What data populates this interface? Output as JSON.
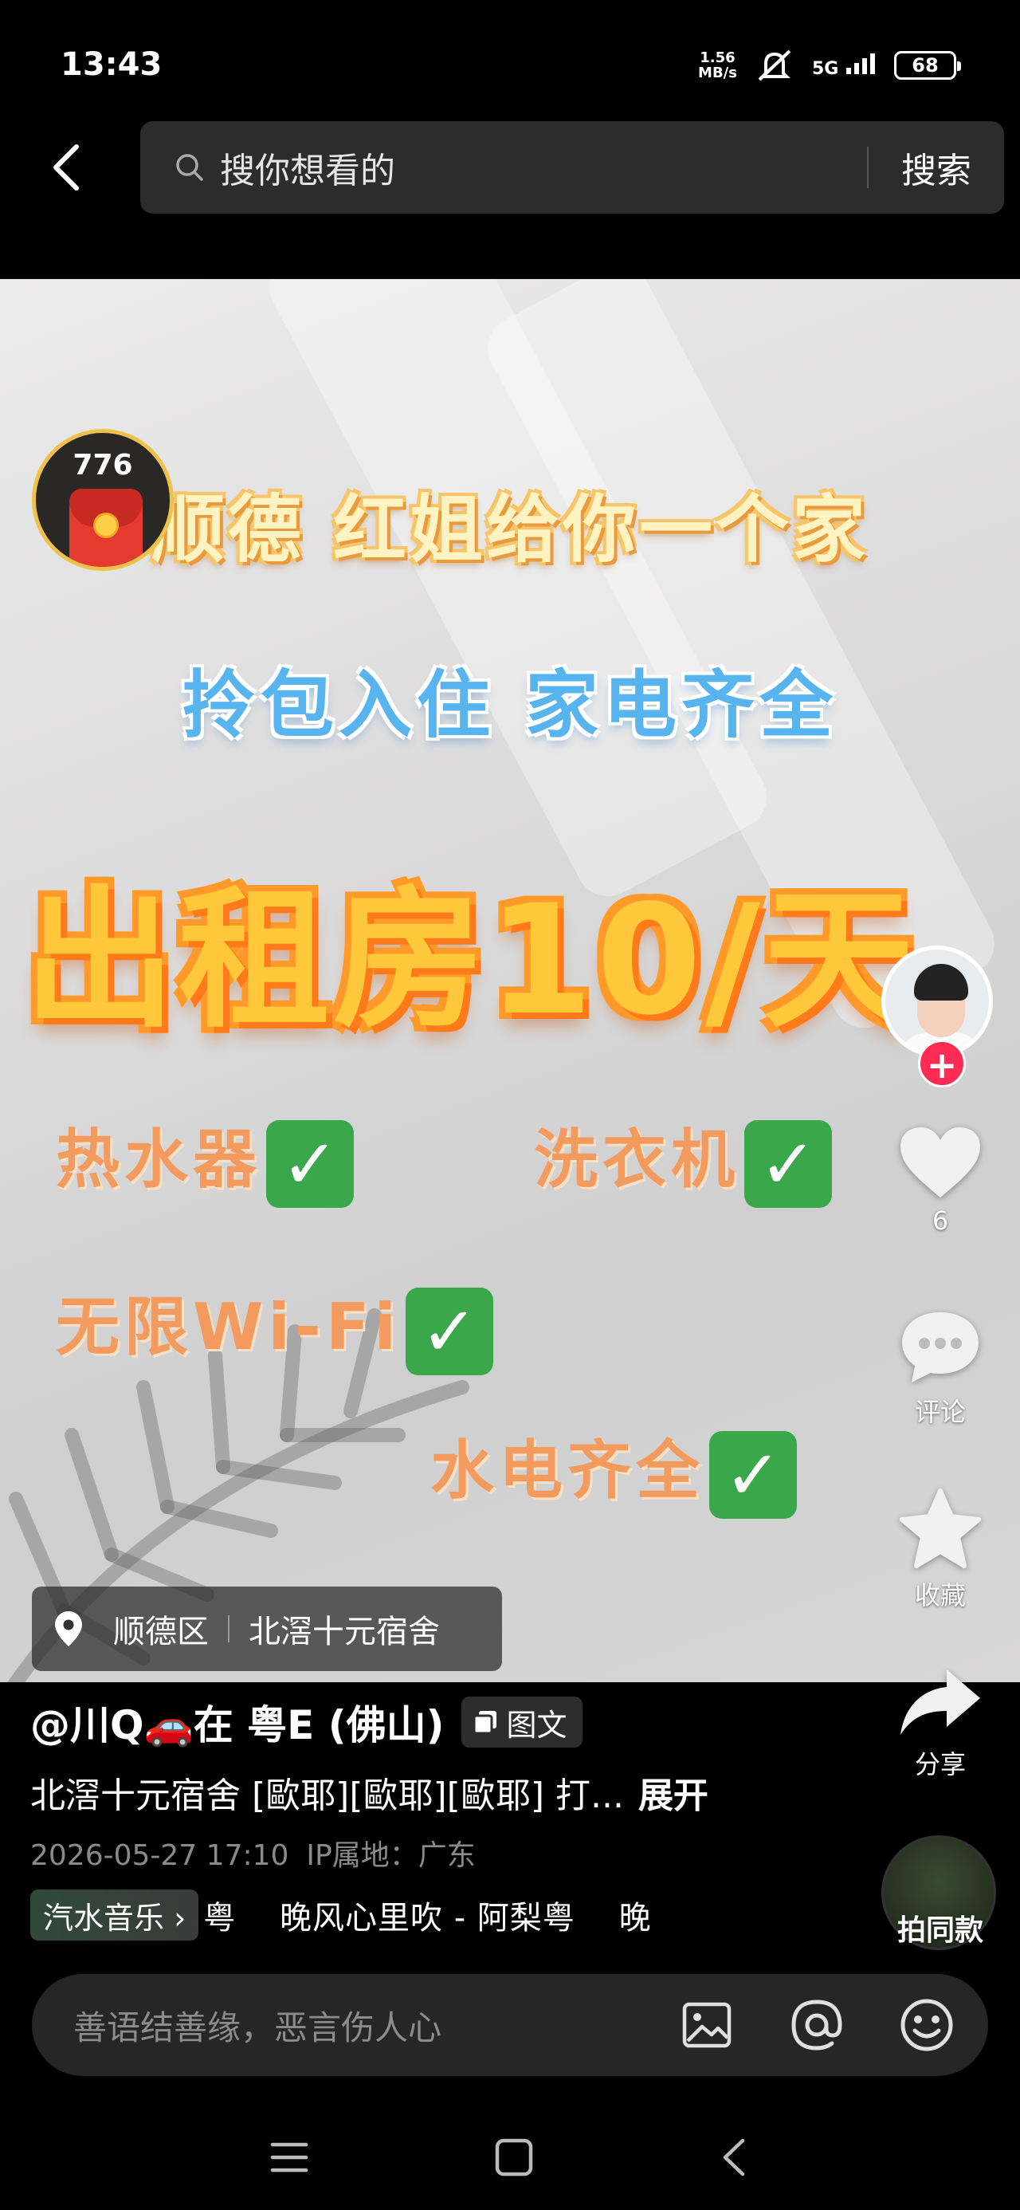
{
  "status_bar": {
    "time": "13:43",
    "net_speed_value": "1.56",
    "net_speed_unit": "MB/s",
    "signal": "5G",
    "battery": "68"
  },
  "search": {
    "placeholder": "搜你想看的",
    "button": "搜索"
  },
  "poster": {
    "title": "顺德 红姐给你一个家",
    "subtitle": "拎包入住 家电齐全",
    "headline": "出租房10/天",
    "features": [
      "热水器",
      "洗衣机",
      "无限Wi-Fi",
      "水电齐全"
    ]
  },
  "red_packet": {
    "count": "776"
  },
  "actions": {
    "like_count": "6",
    "comment_label": "评论",
    "favorite_label": "收藏",
    "share_label": "分享",
    "same_style_label": "拍同款"
  },
  "location": {
    "district": "顺德区",
    "place": "北滘十元宿舍"
  },
  "post": {
    "author": "@川Q🚗在 粤E (佛山)",
    "type_badge": "图文",
    "description": "北滘十元宿舍 [歐耶][歐耶][歐耶] 打...",
    "expand": "展开",
    "datetime": "2026-05-27 17:10",
    "ip_location": "IP属地：广东"
  },
  "music": {
    "chip_label": "汽水音乐 ›",
    "scroll_text": "粤　 晚风心里吹 - 阿梨粤　 晚"
  },
  "comment": {
    "placeholder": "善语结善缘，恶言伤人心"
  },
  "colors": {
    "like_red": "#fe2c55",
    "check_green": "#3aa84a",
    "headline_yellow": "#ffc83a"
  }
}
